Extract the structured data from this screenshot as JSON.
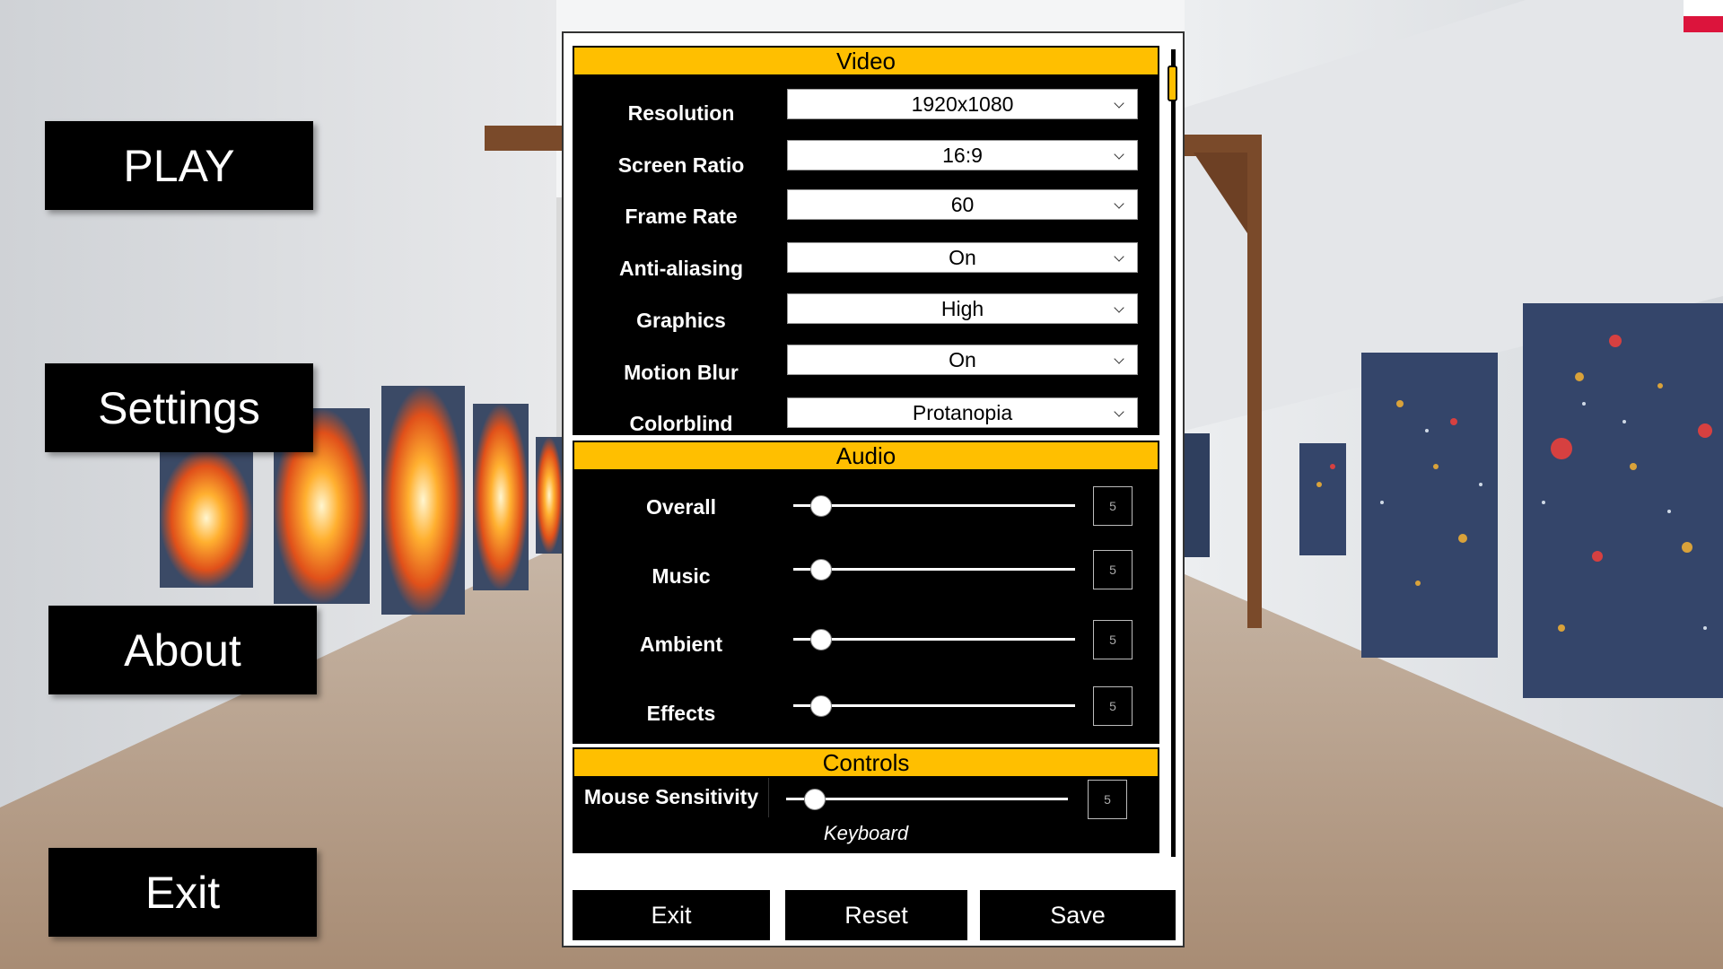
{
  "menu": {
    "play": "PLAY",
    "settings": "Settings",
    "about": "About",
    "exit": "Exit"
  },
  "flag": {
    "icon": "poland-flag-icon",
    "colors": [
      "#ffffff",
      "#dc143c"
    ]
  },
  "accent_color": "#ffbf00",
  "video": {
    "title": "Video",
    "rows": [
      {
        "label": "Resolution",
        "value": "1920x1080"
      },
      {
        "label": "Screen Ratio",
        "value": "16:9"
      },
      {
        "label": "Frame Rate",
        "value": "60"
      },
      {
        "label": "Anti-aliasing",
        "value": "On"
      },
      {
        "label": "Graphics",
        "value": "High"
      },
      {
        "label": "Motion Blur",
        "value": "On"
      },
      {
        "label": "Colorblind",
        "value": "Protanopia"
      }
    ]
  },
  "audio": {
    "title": "Audio",
    "rows": [
      {
        "label": "Overall",
        "value": "5",
        "level": 0.1
      },
      {
        "label": "Music",
        "value": "5",
        "level": 0.1
      },
      {
        "label": "Ambient",
        "value": "5",
        "level": 0.1
      },
      {
        "label": "Effects",
        "value": "5",
        "level": 0.1
      }
    ]
  },
  "controls": {
    "title": "Controls",
    "mouse_label": "Mouse Sensitivity",
    "mouse_value": "5",
    "mouse_level": 0.1,
    "keyboard_label": "Keyboard"
  },
  "footer": {
    "exit": "Exit",
    "reset": "Reset",
    "save": "Save"
  }
}
